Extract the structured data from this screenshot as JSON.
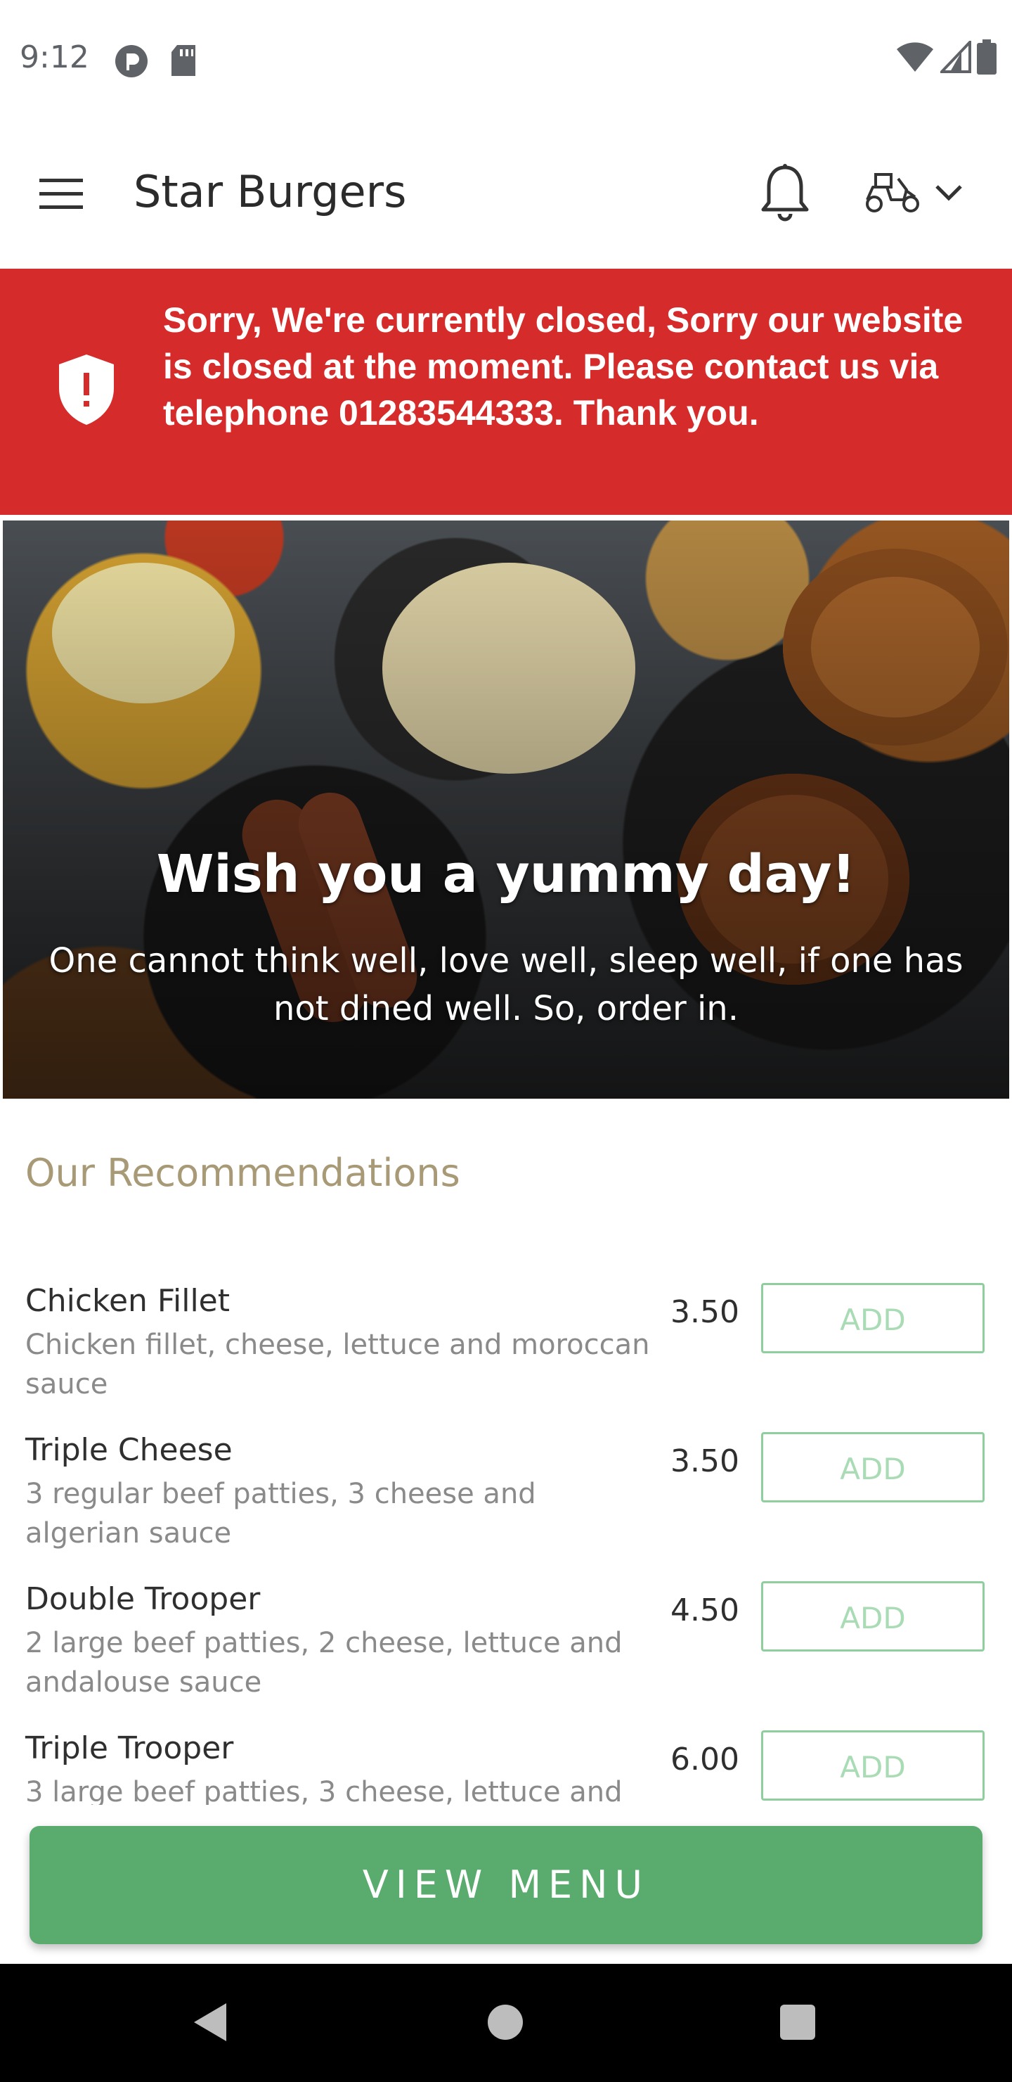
{
  "status_bar": {
    "time": "9:12",
    "left_icons": [
      "record-icon",
      "sd-card-icon"
    ],
    "right_icons": [
      "wifi-icon",
      "signal-icon",
      "battery-icon"
    ]
  },
  "app_bar": {
    "title": "Star Burgers",
    "icons": [
      "hamburger-menu-icon",
      "bell-icon",
      "delivery-scooter-icon",
      "chevron-down-icon"
    ]
  },
  "closed_banner": {
    "icon": "shield-alert-icon",
    "message": "Sorry, We're currently closed, Sorry our website is closed at the moment. Please contact us via telephone 01283544333. Thank you.",
    "background": "#d52b2b"
  },
  "hero": {
    "heading": "Wish you a yummy day!",
    "subtitle": "One cannot think well, love well, sleep well, if one has not dined well. So, order in."
  },
  "recommendations": {
    "title": "Our Recommendations",
    "title_color": "#a89a76",
    "items": [
      {
        "name": "Chicken Fillet",
        "description": "Chicken fillet, cheese, lettuce and moroccan sauce",
        "price": "3.50",
        "button": "ADD"
      },
      {
        "name": "Triple Cheese",
        "description": "3 regular beef patties, 3 cheese and algerian sauce",
        "price": "3.50",
        "button": "ADD"
      },
      {
        "name": "Double Trooper",
        "description": "2 large beef patties, 2 cheese, lettuce and andalouse sauce",
        "price": "4.50",
        "button": "ADD"
      },
      {
        "name": "Triple Trooper",
        "description": "3 large beef patties, 3 cheese, lettuce and",
        "price": "6.00",
        "button": "ADD"
      }
    ]
  },
  "view_menu": {
    "label": "VIEW MENU",
    "color": "#5aac6e"
  },
  "nav_bar": {
    "icons": [
      "back-icon",
      "home-icon",
      "recents-icon"
    ]
  }
}
